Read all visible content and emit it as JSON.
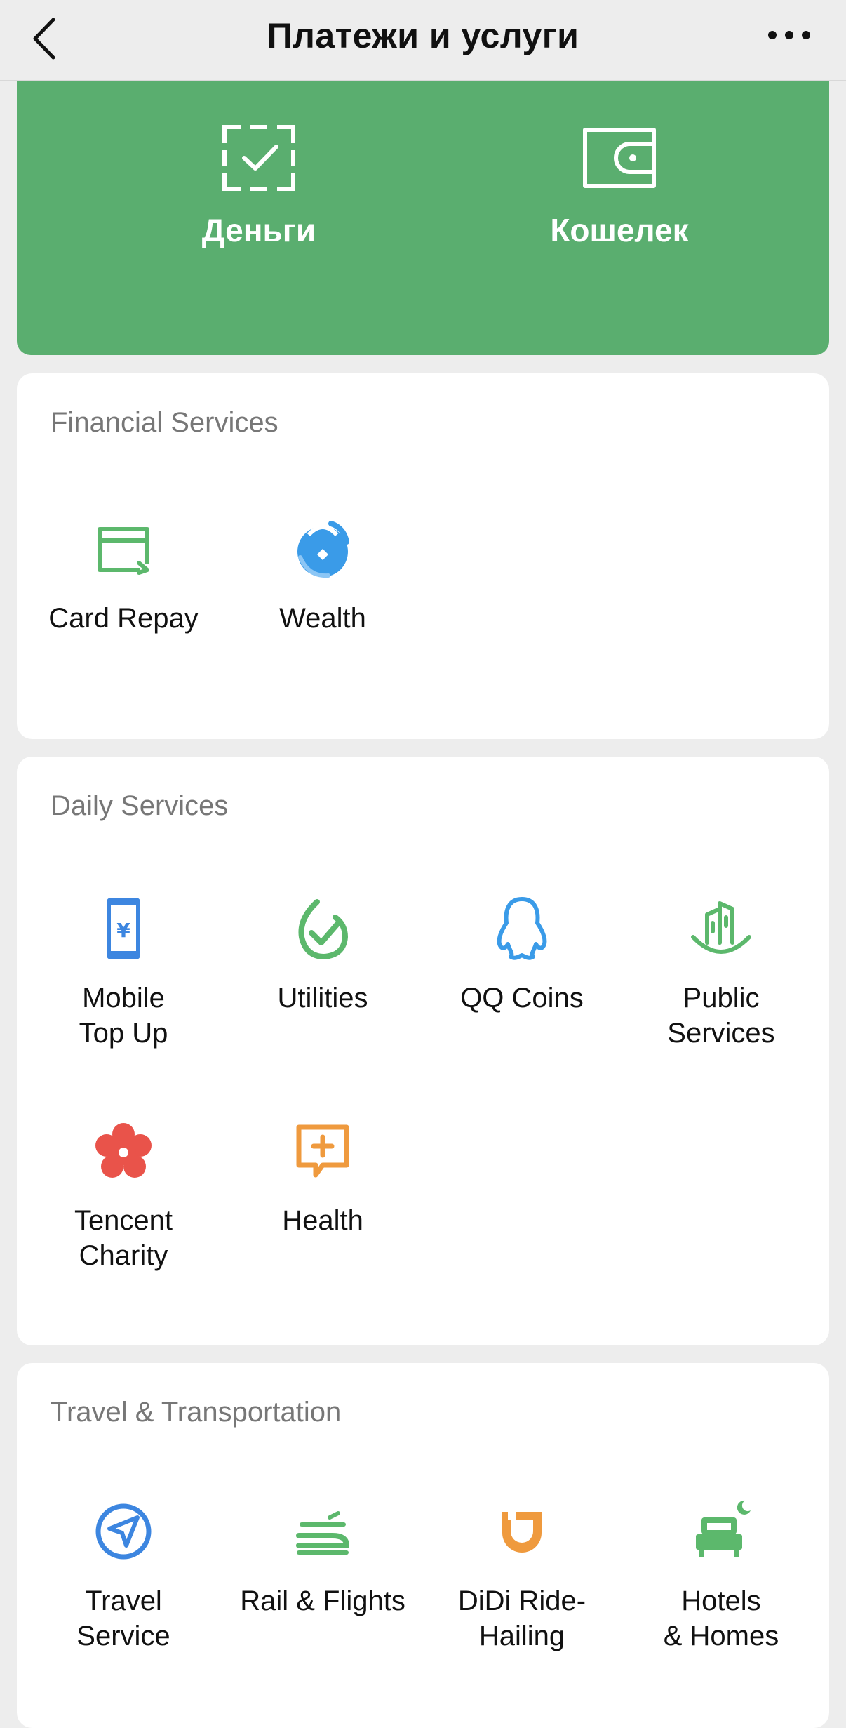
{
  "header": {
    "title": "Платежи и услуги"
  },
  "hero": {
    "money_label": "Деньги",
    "wallet_label": "Кошелек",
    "background": "#5aae6f"
  },
  "financial": {
    "title": "Financial Services",
    "items": [
      {
        "label": "Card Repay",
        "icon": "card-repay-icon"
      },
      {
        "label": "Wealth",
        "icon": "wealth-icon"
      }
    ]
  },
  "daily": {
    "title": "Daily Services",
    "items": [
      {
        "label": "Mobile\nTop Up",
        "icon": "mobile-top-up-icon"
      },
      {
        "label": "Utilities",
        "icon": "utilities-icon"
      },
      {
        "label": "QQ Coins",
        "icon": "qq-coins-icon"
      },
      {
        "label": "Public\nServices",
        "icon": "public-services-icon"
      },
      {
        "label": "Tencent\nCharity",
        "icon": "tencent-charity-icon"
      },
      {
        "label": "Health",
        "icon": "health-icon"
      }
    ]
  },
  "travel": {
    "title": "Travel & Transportation",
    "items": [
      {
        "label": "Travel\nService",
        "icon": "travel-service-icon"
      },
      {
        "label": "Rail & Flights",
        "icon": "rail-flights-icon"
      },
      {
        "label": "DiDi Ride-\nHailing",
        "icon": "didi-ride-hailing-icon"
      },
      {
        "label": "Hotels\n& Homes",
        "icon": "hotels-homes-icon"
      }
    ]
  },
  "colors": {
    "green": "#5cb86c",
    "blue": "#3d86e0",
    "orange": "#ef9a3e",
    "red": "#e9534a"
  }
}
